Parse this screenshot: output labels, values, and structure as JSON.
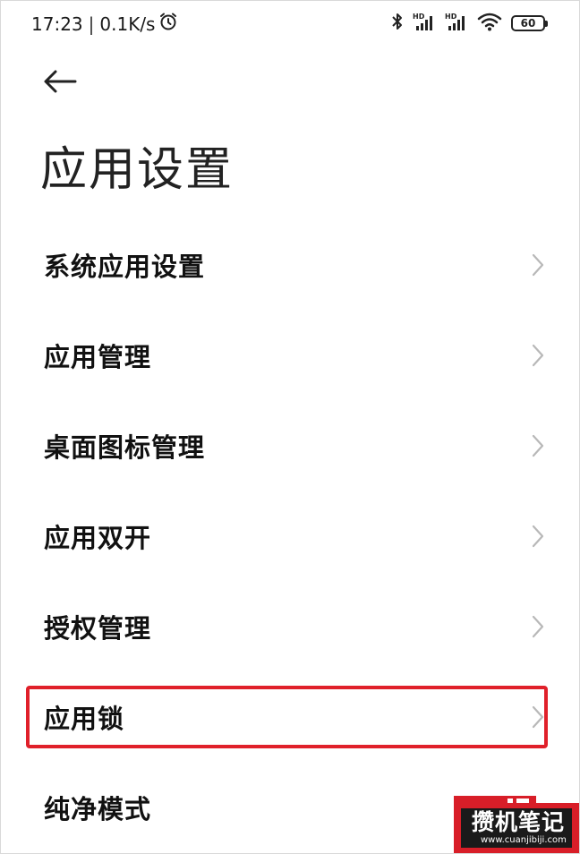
{
  "status_bar": {
    "time": "17:23",
    "separator": "|",
    "network_speed": "0.1K/s",
    "battery_level": "60",
    "icons": [
      "alarm-icon",
      "bluetooth-icon",
      "hd-signal-icon",
      "hd-signal-icon",
      "wifi-icon",
      "battery-icon"
    ]
  },
  "header": {
    "back_icon": "back-arrow-icon",
    "title": "应用设置"
  },
  "settings": {
    "items": [
      {
        "label": "系统应用设置"
      },
      {
        "label": "应用管理"
      },
      {
        "label": "桌面图标管理"
      },
      {
        "label": "应用双开"
      },
      {
        "label": "授权管理"
      },
      {
        "label": "应用锁"
      },
      {
        "label": "纯净模式"
      }
    ]
  },
  "highlight": {
    "target": "应用锁",
    "color": "#e0202a"
  },
  "watermark": {
    "name": "攒机笔记",
    "url": "www.cuanjibiji.com",
    "color": "#d81e28"
  }
}
